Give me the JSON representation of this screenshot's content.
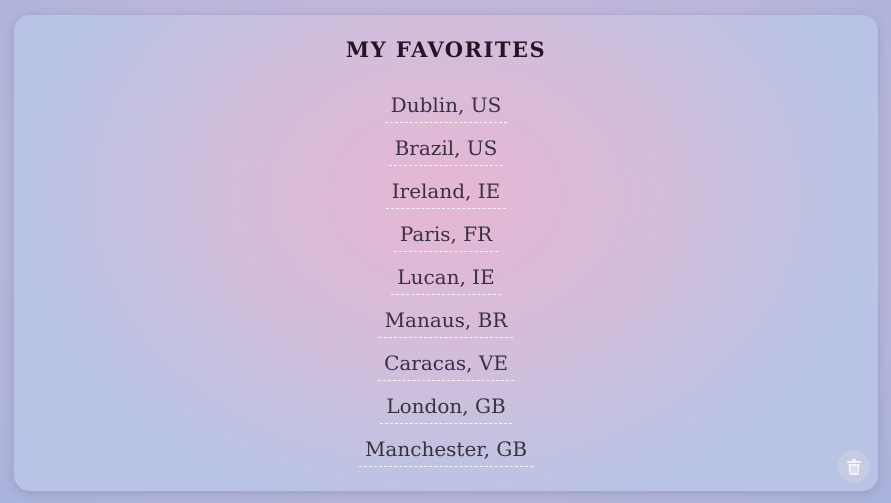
{
  "panel": {
    "title": "MY FAVORITES"
  },
  "favorites": [
    {
      "label": "Dublin, US"
    },
    {
      "label": "Brazil, US"
    },
    {
      "label": "Ireland, IE"
    },
    {
      "label": "Paris, FR"
    },
    {
      "label": "Lucan, IE"
    },
    {
      "label": "Manaus, BR"
    },
    {
      "label": "Caracas, VE"
    },
    {
      "label": "London, GB"
    },
    {
      "label": "Manchester, GB"
    }
  ],
  "actions": {
    "clear_icon": "trash-icon"
  }
}
